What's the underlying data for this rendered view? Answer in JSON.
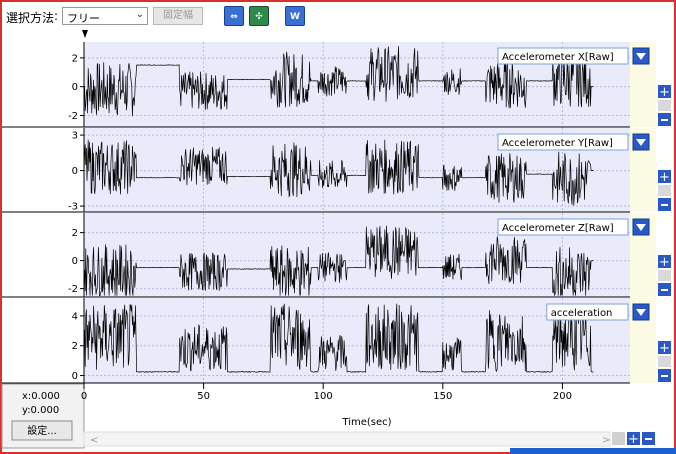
{
  "toolbar": {
    "selection_label": "選択方法",
    "selection_value": "フリー",
    "fixed_width_label": "固定幅"
  },
  "side": {
    "x_readout": "x:0.000",
    "y_readout": "y:0.000",
    "settings_label": "設定..."
  },
  "colors": {
    "plot_bg": "#e9ebfb",
    "side_band": "#fbfbe3",
    "accent": "#2a58c5",
    "frame": "#d9302b"
  },
  "chart_data": [
    {
      "type": "line",
      "series": [
        {
          "name": "Accelerometer X[Raw]"
        }
      ],
      "y_ticks": [
        "2",
        "0",
        "-2"
      ],
      "ylim": [
        -2.8,
        3.1
      ]
    },
    {
      "type": "line",
      "series": [
        {
          "name": "Accelerometer Y[Raw]"
        }
      ],
      "y_ticks": [
        "3",
        "0",
        "-3"
      ],
      "ylim": [
        -3.5,
        3.6
      ]
    },
    {
      "type": "line",
      "series": [
        {
          "name": "Accelerometer Z[Raw]"
        }
      ],
      "y_ticks": [
        "2",
        "0",
        "-2"
      ],
      "ylim": [
        -2.6,
        3.4
      ]
    },
    {
      "type": "line",
      "series": [
        {
          "name": "acceleration"
        }
      ],
      "y_ticks": [
        "4",
        "2",
        "0"
      ],
      "ylim": [
        -0.5,
        5.2
      ],
      "xlabel": "Time(sec)",
      "x_ticks": [
        "0",
        "50",
        "100",
        "150",
        "200"
      ],
      "xlim": [
        0,
        227
      ]
    }
  ]
}
